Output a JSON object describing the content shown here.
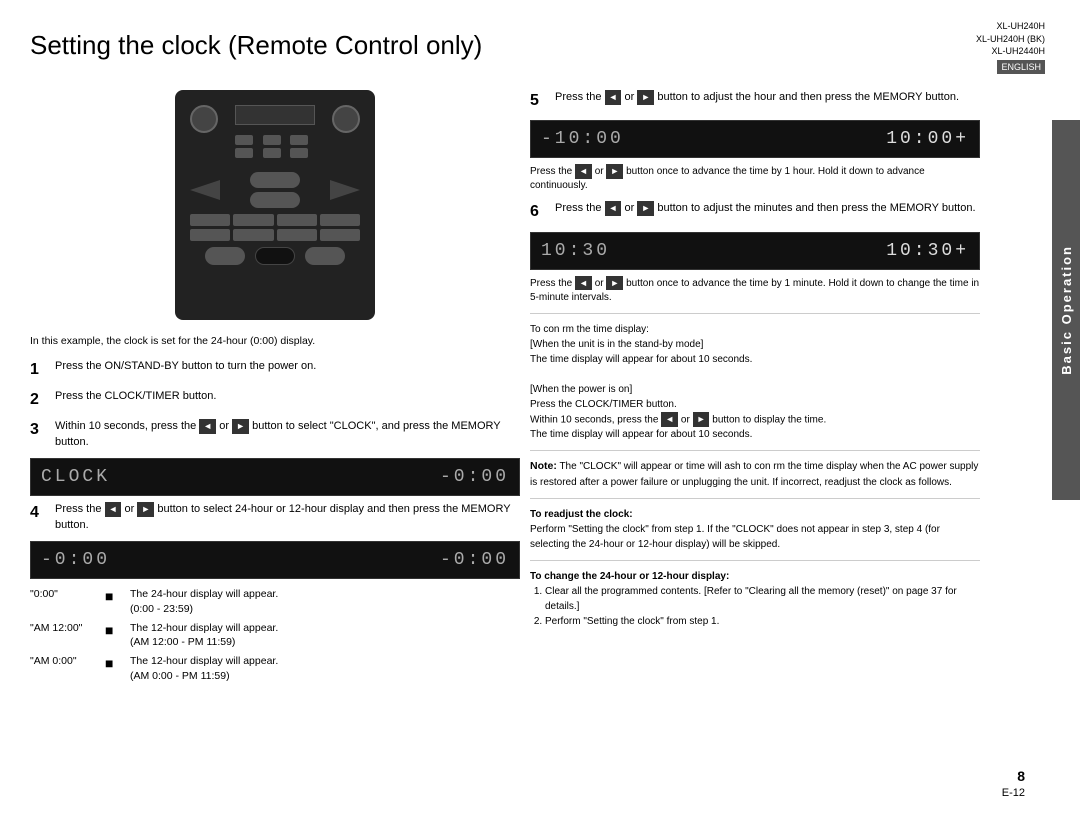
{
  "page": {
    "title": "Setting the clock (Remote Control only)",
    "page_number": "8",
    "page_label": "E-12"
  },
  "model_info": {
    "lines": [
      "XL-UH240H",
      "XL-UH240H (BK)",
      "XL-UH2440H"
    ],
    "badge": "ENGLISH"
  },
  "side_tab": {
    "label": "Basic Operation"
  },
  "example_note": "In this example, the clock is set for the 24-hour (0:00) display.",
  "steps_left": [
    {
      "number": "1",
      "text": "Press the ON/STAND-BY button to turn the power on."
    },
    {
      "number": "2",
      "text": "Press the CLOCK/TIMER button."
    },
    {
      "number": "3",
      "text": "Within 10 seconds, press the       or       button to select \"CLOCK\", and press the MEMORY button."
    },
    {
      "number": "4",
      "text": "Press the      or      button to select 24-hour or 12-hour display and then press the MEMORY button."
    }
  ],
  "display_screens": {
    "clock_screen": [
      "CLOCK",
      "-0:00"
    ],
    "hour_select_screen": [
      "-0:00",
      "-0:00"
    ],
    "step5_screen": [
      "-10:00",
      "10:00+"
    ],
    "step6_screen": [
      "10:30",
      "10:30+"
    ]
  },
  "time_options": [
    {
      "label": "\"0:00\"",
      "arrow": "■",
      "desc": "The 24-hour display will appear.\n(0:00 - 23:59)"
    },
    {
      "label": "\"AM 12:00\"",
      "arrow": "■",
      "desc": "The 12-hour display will appear.\n(AM 12:00 - PM 11:59)"
    },
    {
      "label": "\"AM 0:00\"",
      "arrow": "■",
      "desc": "The 12-hour display will appear.\n(AM 0:00 - PM 11:59)"
    }
  ],
  "steps_right": [
    {
      "number": "5",
      "text": "Press the      or      button to adjust the hour and then press the MEMORY button."
    },
    {
      "number": "6",
      "text": "Press the      or      button to adjust the minutes and then press the MEMORY button."
    }
  ],
  "step5_note": "Press the      or      button once to advance the time by 1 hour. Hold it down to advance continuously.",
  "step6_note": "Press the      or      button once to advance the time by 1 minute. Hold it down to change the time in 5-minute intervals.",
  "confirm_time_display": {
    "title": "To con rm the time display:",
    "when_standby": "[When the unit is in the stand-by mode]",
    "standby_text": "The time display will appear for about 10 seconds.",
    "when_power_on": "[When the power is on]",
    "power_on_text": "Press the CLOCK/TIMER button.\nWithin 10 seconds, press the      or      button to display the time.\nThe time display will appear for about 10 seconds."
  },
  "note": {
    "label": "Note:",
    "text": "The \"CLOCK\" will appear or time will  ash to con rm the time display when the AC power supply is restored after a power failure or unplugging the unit. If incorrect, readjust the clock as follows."
  },
  "readjust": {
    "title": "To readjust the clock:",
    "text": "Perform \"Setting the clock\" from step 1. If the \"CLOCK\" does not appear in step 3, step 4 (for selecting the 24-hour or 12-hour display) will be skipped."
  },
  "change_display": {
    "title": "To change the 24-hour or 12-hour display:",
    "steps": [
      "Clear all the programmed contents. [Refer to \"Clearing all the memory (reset)\" on page 37 for details.]",
      "Perform \"Setting the clock\" from step 1."
    ]
  }
}
